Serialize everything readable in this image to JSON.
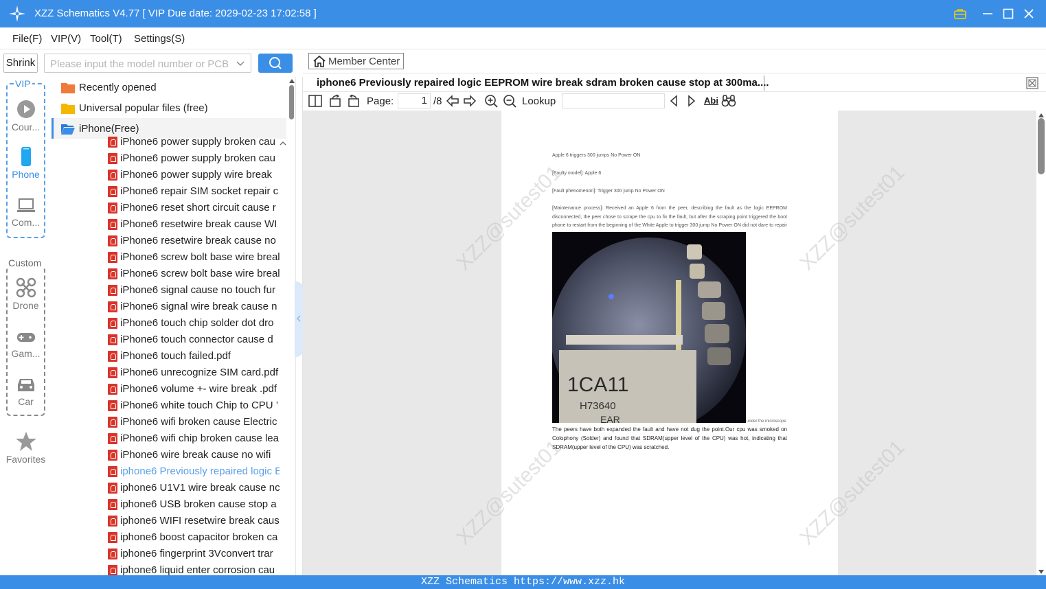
{
  "window": {
    "title": "XZZ Schematics V4.77 [ VIP Due date: 2029-02-23 17:02:58 ]"
  },
  "menu": [
    "File(F)",
    "VIP(V)",
    "Tool(T)",
    "Settings(S)"
  ],
  "search": {
    "shrink_label": "Shrink",
    "placeholder": "Please input the model number or PCB"
  },
  "nav": {
    "vip_label": "VIP",
    "custom_label": "Custom",
    "items": [
      {
        "label": "Cour...",
        "icon": "play-icon"
      },
      {
        "label": "Phone",
        "icon": "phone-icon"
      },
      {
        "label": "Com...",
        "icon": "laptop-icon"
      },
      {
        "label": "Drone",
        "icon": "drone-icon"
      },
      {
        "label": "Gam...",
        "icon": "gamepad-icon"
      },
      {
        "label": "Car",
        "icon": "car-icon"
      },
      {
        "label": "Favorites",
        "icon": "star-icon"
      }
    ]
  },
  "tree": {
    "folders": [
      "Recently opened",
      "Universal popular files (free)",
      "iPhone(Free)"
    ],
    "files": [
      "iPhone6 power supply broken cau",
      "iPhone6 power supply broken cau",
      "iPhone6 power supply wire break",
      "iPhone6 repair SIM socket repair c",
      "iPhone6 reset short circuit cause  r",
      "iPhone6 resetwire break  cause WI",
      "iPhone6 resetwire break  cause no",
      "iPhone6 screw bolt base wire breal",
      "iPhone6 screw bolt base wire breal",
      "iPhone6 signal cause no touch fur",
      "iPhone6 signal wire break  cause n",
      "iPhone6 touch chip solder dot dro",
      "iPhone6 touch connector cause  d",
      "iPhone6 touch failed.pdf",
      "iPhone6 unrecognize SIM card.pdf",
      "iPhone6 volume +- wire break .pdf",
      "iPhone6 white touch Chip to CPU ’",
      "iPhone6 wifi broken cause Electric",
      "iPhone6 wifi chip broken cause lea",
      "iPhone6 wire break  cause no wifi",
      "iphone6 Previously repaired logic E",
      "iphone6 U1V1 wire break  cause nc",
      "iphone6 USB broken cause  stop a",
      "iphone6 WIFI resetwire break  caus",
      "iphone6 boost capacitor broken ca",
      "iphone6 fingerprint 3Vconvert trar",
      "iphone6 liquid enter corrosion cau"
    ]
  },
  "viewer": {
    "member_center": "Member Center",
    "doc_title": "iphone6 Previously repaired logic EEPROM wire break sdram broken cause stop at 300ma....",
    "page_label": "Page:",
    "page_current": "1",
    "page_total": "/8",
    "lookup_label": "Lookup",
    "abi_label": "Abi"
  },
  "document": {
    "line1": "Apple 6 triggers 300 jumps No Power ON",
    "line2": "[Faulty model]: Apple 6",
    "line3": "[Fault phenomenon]: Trigger 300 jump No Power ON",
    "para1": "[Maintenance process]: Received an Apple 6 from the peer, describing the fault as the logic EEPROM disconnected, the peer chose to scrape the cpu to fix the fault, but after the scraping point triggered the boot phone to restart from the beginning of the White Apple to trigger 300 jump No Power ON did not dare to repair it, so sent it to us, observe",
    "caption": "under the microscope",
    "photo_text1": "1CA11",
    "photo_text2": "H73640",
    "photo_text3": "EAR",
    "para2": "The peers have both expanded the fault and have not dug the point.Our cpu was smoked on Colophony (Solder) and found that SDRAM(upper level of the CPU) was hot, indicating that SDRAM(upper level of the CPU) was scratched.",
    "watermark": "XZZ@sutest01"
  },
  "status": "XZZ Schematics https://www.xzz.hk",
  "colors": {
    "accent": "#3a8ee6",
    "pdf": "#d9342b",
    "folder": "#f5b800",
    "folder_recent": "#f07a3a"
  }
}
